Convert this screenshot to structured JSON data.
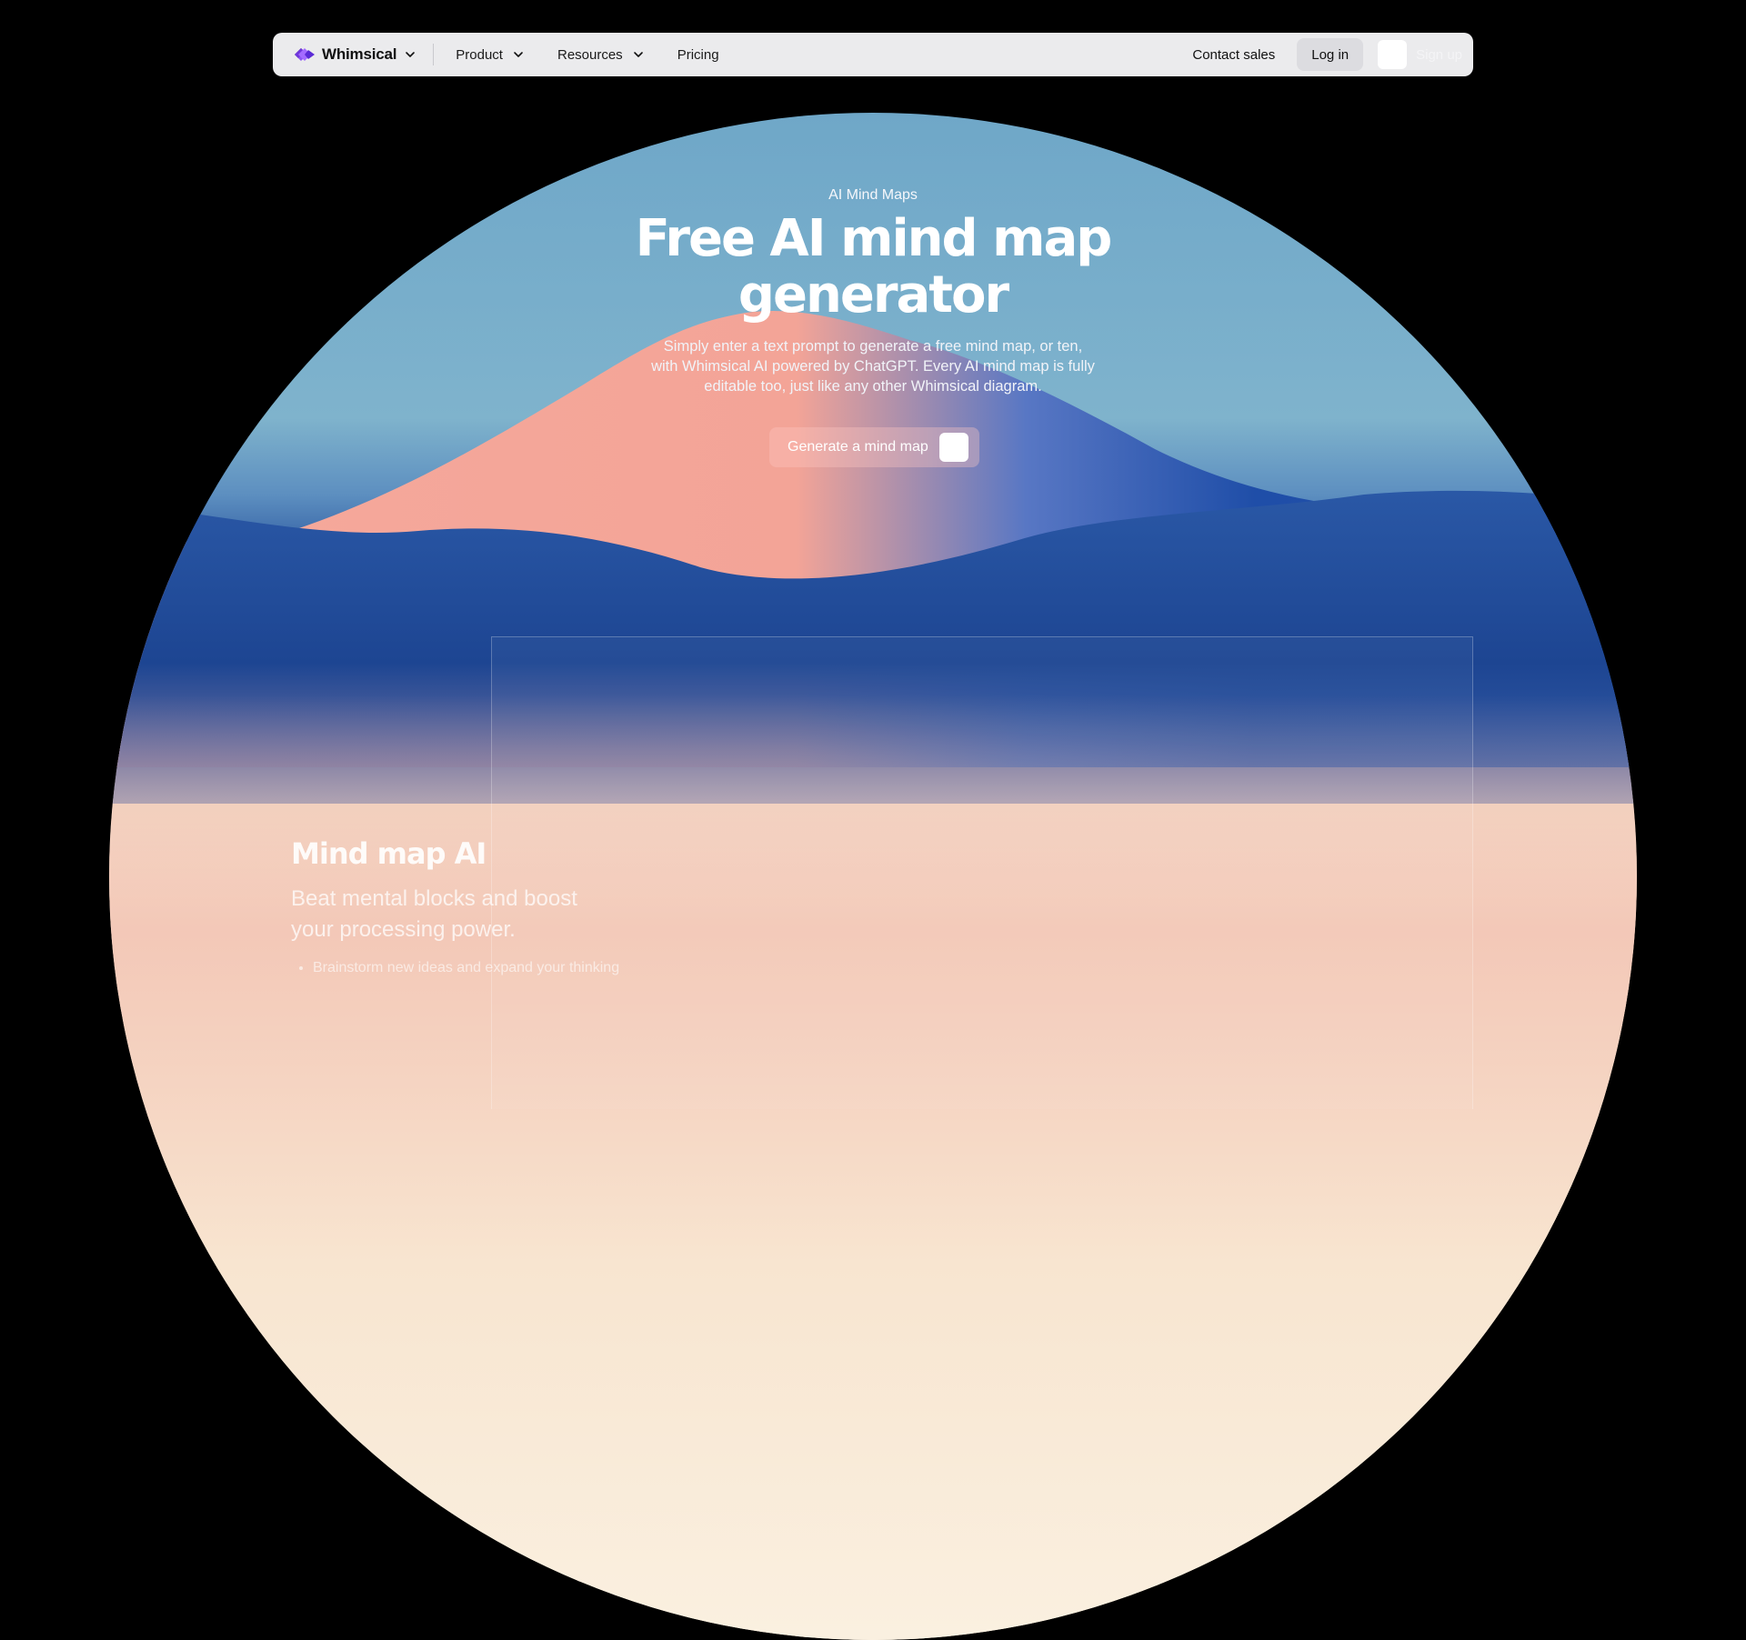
{
  "nav": {
    "brand": "Whimsical",
    "items": [
      {
        "label": "Product",
        "has_dropdown": true
      },
      {
        "label": "Resources",
        "has_dropdown": true
      },
      {
        "label": "Pricing",
        "has_dropdown": false
      }
    ],
    "contact_label": "Contact sales",
    "login_label": "Log in",
    "signup_label": "Sign up"
  },
  "hero": {
    "eyebrow": "AI Mind Maps",
    "title": "Free AI mind map generator",
    "subtitle": "Simply enter a text prompt to generate a free mind map, or ten, with Whimsical AI powered by ChatGPT. Every AI mind map is fully editable too, just like any other Whimsical diagram.",
    "cta_label": "Generate a mind map"
  },
  "feature": {
    "title": "Mind map AI",
    "subtitle": "Beat mental blocks and boost your processing power.",
    "bullets": [
      "Brainstorm new ideas and expand your thinking"
    ]
  },
  "colors": {
    "nav_bg": "#ebebed",
    "brand_purple": "#7b3cf2",
    "sky": "#7fb3cc",
    "mountain_pink": "#f3a497",
    "mountain_blue": "#1e4690",
    "mist": "#faf0e0"
  },
  "icons": {
    "logo": "whimsical-logo-icon",
    "dropdown": "chevron-down-icon"
  }
}
